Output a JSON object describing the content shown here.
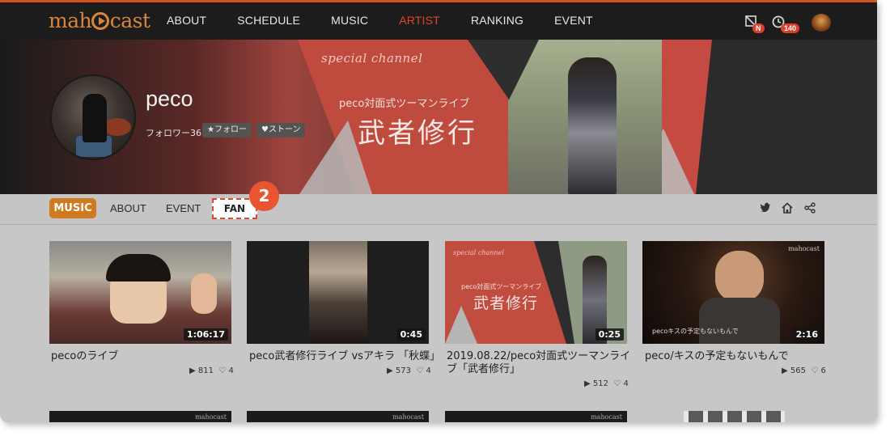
{
  "nav": {
    "logo": "mahocast",
    "links": [
      "ABOUT",
      "SCHEDULE",
      "MUSIC",
      "ARTIST",
      "RANKING",
      "EVENT"
    ],
    "active": "ARTIST",
    "notif_badge": "N",
    "history_badge": "140"
  },
  "artist": {
    "name": "peco",
    "followers": "フォロワー36",
    "follow_label": "★フォロー",
    "stone_label": "♥ストーン"
  },
  "banner": {
    "special": "special channel",
    "subtitle": "peco対面式ツーマンライブ",
    "title": "武者修行"
  },
  "tabs": [
    "MUSIC",
    "ABOUT",
    "EVENT",
    "FAN"
  ],
  "step": "2",
  "videos": [
    {
      "title": "pecoのライブ",
      "duration": "1:06:17",
      "plays": "811",
      "likes": "4"
    },
    {
      "title": "peco武者修行ライブ vsアキラ 「秋蝶」",
      "duration": "0:45",
      "plays": "573",
      "likes": "4"
    },
    {
      "title": "2019.08.22/peco対面式ツーマンライブ「武者修行」",
      "duration": "0:25",
      "plays": "512",
      "likes": "4"
    },
    {
      "title": "peco/キスの予定もないもんで",
      "duration": "2:16",
      "plays": "565",
      "likes": "6"
    }
  ],
  "thumb3": {
    "special": "special channel",
    "subtitle": "peco対面式ツーマンライブ",
    "title": "武者修行"
  },
  "thumb4_caption": "pecoキスの予定もないもんで",
  "watermark": "mahocast",
  "colors": {
    "accent": "#d4531c",
    "active_nav": "#e0452b",
    "music_tab": "#cf7a1e",
    "badge": "#d9402c"
  }
}
